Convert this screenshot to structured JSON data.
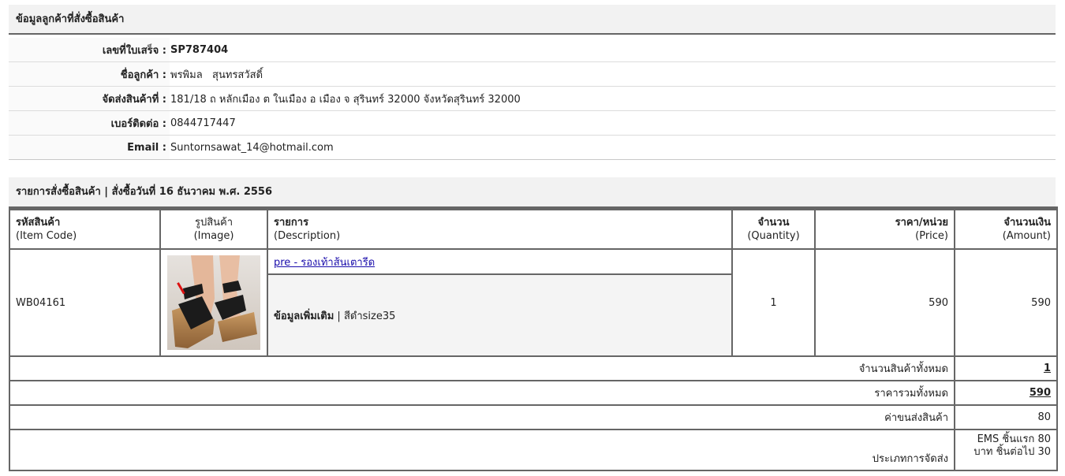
{
  "customer_section": {
    "title": "ข้อมูลลูกค้าที่สั่งซื้อสินค้า",
    "rows": [
      {
        "label": "เลขที่ใบเสร็จ :",
        "value": "SP787404"
      },
      {
        "label": "ชื่อลูกค้า :",
        "value": "พรพิมล   สุนทรสวัสดิ์"
      },
      {
        "label": "จัดส่งสินค้าที่ :",
        "value": "181/18 ถ หลักเมือง ต ในเมือง อ เมือง จ สุรินทร์ 32000 จังหวัดสุรินทร์ 32000"
      },
      {
        "label": "เบอร์ติดต่อ :",
        "value": "0844717447"
      },
      {
        "label": "Email :",
        "value": "Suntornsawat_14@hotmail.com"
      }
    ]
  },
  "order_section": {
    "title": "รายการสั่งซื้อสินค้า | สั่งซื้อวันที่ 16 ธันวาคม พ.ศ. 2556",
    "headers": [
      {
        "th": "รหัสสินค้า",
        "en": "(Item Code)"
      },
      {
        "th": "รูปสินค้า",
        "en": "(Image)"
      },
      {
        "th": "รายการ",
        "en": "(Description)"
      },
      {
        "th": "จำนวน",
        "en": "(Quantity)"
      },
      {
        "th": "ราคา/หน่วย",
        "en": "(Price)"
      },
      {
        "th": "จำนวนเงิน",
        "en": "(Amount)"
      }
    ],
    "items": [
      {
        "code": "WB04161",
        "image_icon": "shoe-photo",
        "name": "pre - รองเท้าส้นเตารีด",
        "extra_label": "ข้อมูลเพิ่มเติม",
        "extra_sep": "|",
        "extra_value": "สีดำsize35",
        "quantity": "1",
        "price": "590",
        "amount": "590"
      }
    ],
    "summary": {
      "total_items_label": "จำนวนสินค้าทั้งหมด",
      "total_items_value": "1",
      "total_price_label": "ราคารวมทั้งหมด",
      "total_price_value": "590",
      "shipping_label": "ค่าขนส่งสินค้า",
      "shipping_value": "80",
      "shipping_type_label": "ประเภทการจัดส่ง",
      "shipping_type_line1": "EMS ชิ้นแรก 80",
      "shipping_type_line2": "บาท ชิ้นต่อไป 30"
    }
  },
  "colors": {
    "header_bg": "#f2f2f2",
    "border": "#666666",
    "link": "#1a0dab"
  }
}
